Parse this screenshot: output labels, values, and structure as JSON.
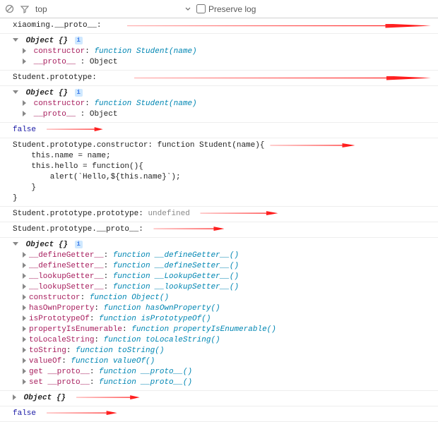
{
  "toolbar": {
    "filter_text": "top",
    "preserve_label": "Preserve log",
    "preserve_checked": false
  },
  "entries": {
    "e1_label": "xiaoming.__proto__:",
    "obj_label": "Object {}",
    "constructor_key": "constructor",
    "student_func": "function Student(name)",
    "proto_key": "__proto__",
    "proto_val_obj": ": Object",
    "e3_label": "Student.prototype:",
    "false_val": "false",
    "e5_head": "Student.prototype.constructor: function Student(name){",
    "e5_l1": "    this.name = name;",
    "e5_l2": "    this.hello = function(){",
    "e5_l3": "        alert(`Hello,${this.name}`);",
    "e5_l4": "    }",
    "e5_l5": "}",
    "e6_label": "Student.prototype.prototype: ",
    "undefined_val": "undefined",
    "e7_label": "Student.prototype.__proto__:",
    "proto_methods": [
      {
        "k": "__defineGetter__",
        "f": "function __defineGetter__()"
      },
      {
        "k": "__defineSetter__",
        "f": "function __defineSetter__()"
      },
      {
        "k": "__lookupGetter__",
        "f": "function __LookupGetter__()"
      },
      {
        "k": "__lookupSetter__",
        "f": "function __lookupSetter__()"
      },
      {
        "k": "constructor",
        "f": "function Object()"
      },
      {
        "k": "hasOwnProperty",
        "f": "function hasOwnProperty()"
      },
      {
        "k": "isPrototypeOf",
        "f": "function isPrototypeOf()"
      },
      {
        "k": "propertyIsEnumerable",
        "f": "function propertyIsEnumerable()"
      },
      {
        "k": "toLocaleString",
        "f": "function toLocaleString()"
      },
      {
        "k": "toString",
        "f": "function toString()"
      },
      {
        "k": "valueOf",
        "f": "function valueOf()"
      },
      {
        "k": "get __proto__",
        "f": "function __proto__()"
      },
      {
        "k": "set __proto__",
        "f": "function __proto__()"
      }
    ]
  }
}
